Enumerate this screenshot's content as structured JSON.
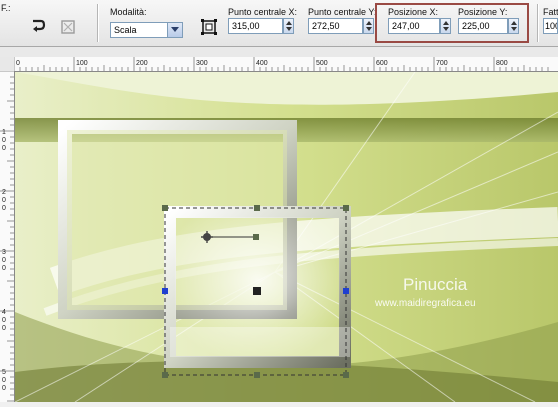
{
  "toolbar": {
    "partial_label": "F.:",
    "mode_label": "Modalità:",
    "mode_value": "Scala",
    "center_x_label": "Punto centrale X:",
    "center_x_value": "315,00",
    "center_y_label": "Punto centrale Y:",
    "center_y_value": "272,50",
    "pos_x_label": "Posizione X:",
    "pos_x_value": "247,00",
    "pos_y_label": "Posizione Y:",
    "pos_y_value": "225,00",
    "partial_right_label": "Fatt",
    "partial_right_value": "100"
  },
  "ruler": {
    "top_labels": [
      "0",
      "100",
      "200",
      "300",
      "400",
      "500",
      "600",
      "700",
      "800"
    ],
    "left_labels": [
      "1\n0\n0",
      "2\n0\n0",
      "3\n0\n0",
      "4\n0\n0",
      "5\n0\n0"
    ]
  },
  "watermark": {
    "name": "Pinuccia",
    "url": "www.maidiregrafica.eu"
  },
  "colors": {
    "highlight_border": "#9a4a44",
    "canvas_green": "#c8d87a",
    "handle_color": "#5a6a4a"
  }
}
